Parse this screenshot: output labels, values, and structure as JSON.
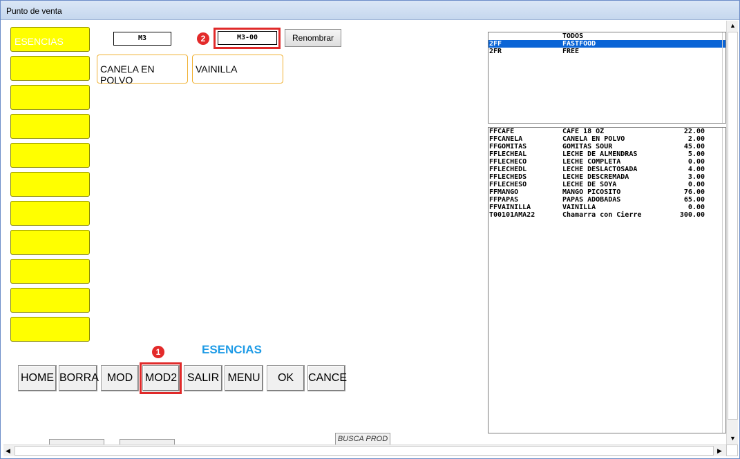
{
  "window": {
    "title": "Punto de venta"
  },
  "categories": [
    "ESENCIAS",
    "",
    "",
    "",
    "",
    "",
    "",
    "",
    "",
    "",
    ""
  ],
  "fields": {
    "group": "M3",
    "subgroup": "M3-00"
  },
  "annotations": {
    "badge1": "1",
    "badge2": "2"
  },
  "buttons": {
    "rename": "Renombrar",
    "toolbar": [
      "HOME",
      "BORRA",
      "MOD",
      "MOD2",
      "SALIR",
      "MENU",
      "OK",
      "CANCE"
    ],
    "partial": "BUSCA PROD"
  },
  "items": [
    "CANELA EN POLVO",
    "VAINILLA"
  ],
  "selected_category_title": "ESENCIAS",
  "groups_list": [
    {
      "code": "",
      "name": "TODOS",
      "selected": false
    },
    {
      "code": "2FF",
      "name": "FASTFOOD",
      "selected": true
    },
    {
      "code": "2FR",
      "name": "FREE",
      "selected": false
    }
  ],
  "products_list": [
    {
      "code": "FFCAFE",
      "name": "CAFE 18 OZ",
      "price": "22.00"
    },
    {
      "code": "FFCANELA",
      "name": "CANELA EN POLVO",
      "price": "2.00"
    },
    {
      "code": "FFGOMITAS",
      "name": "GOMITAS SOUR",
      "price": "45.00"
    },
    {
      "code": "FFLECHEAL",
      "name": "LECHE DE ALMENDRAS",
      "price": "5.00"
    },
    {
      "code": "FFLECHECO",
      "name": "LECHE COMPLETA",
      "price": "0.00"
    },
    {
      "code": "FFLECHEDL",
      "name": "LECHE DESLACTOSADA",
      "price": "4.00"
    },
    {
      "code": "FFLECHEDS",
      "name": "LECHE DESCREMADA",
      "price": "3.00"
    },
    {
      "code": "FFLECHESO",
      "name": "LECHE DE SOYA",
      "price": "0.00"
    },
    {
      "code": "FFMANGO",
      "name": "MANGO PICOSITO",
      "price": "76.00"
    },
    {
      "code": "FFPAPAS",
      "name": "PAPAS ADOBADAS",
      "price": "65.00"
    },
    {
      "code": "FFVAINILLA",
      "name": "VAINILLA",
      "price": "0.00"
    },
    {
      "code": "T00101AMA22",
      "name": "Chamarra con Cierre",
      "price": "300.00"
    }
  ],
  "colors": {
    "category": "#ffff00",
    "selection": "#0a64d6",
    "title": "#1e9be6",
    "annotation": "#e02a2a"
  }
}
